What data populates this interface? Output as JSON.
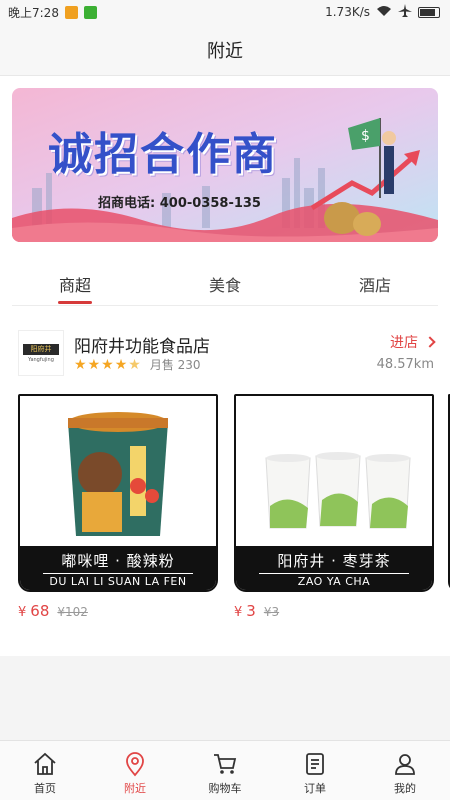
{
  "status_bar": {
    "time": "晚上7:28",
    "network_speed": "1.73K/s",
    "icons": [
      "notification-icon",
      "wechat-icon",
      "wifi-icon",
      "airplane-icon",
      "battery-icon"
    ]
  },
  "header": {
    "title": "附近"
  },
  "banner": {
    "headline": "诚招合作商",
    "hotline": "招商电话: 400-0358-135"
  },
  "tabs": [
    {
      "label": "商超",
      "active": true
    },
    {
      "label": "美食",
      "active": false
    },
    {
      "label": "酒店",
      "active": false
    }
  ],
  "store": {
    "logo_text": "阳府井",
    "logo_sub": "Yangfujing",
    "name": "阳府井功能食品店",
    "rating": 4.5,
    "monthly_sales": "月售 230",
    "enter_label": "进店",
    "distance": "48.57km"
  },
  "products": [
    {
      "name_cn": "嘟咪哩 · 酸辣粉",
      "name_en": "DU LAI LI SUAN LA FEN",
      "currency": "¥",
      "price": "68",
      "original_price": "¥102"
    },
    {
      "name_cn": "阳府井 · 枣芽茶",
      "name_en": "ZAO YA CHA",
      "currency": "¥",
      "price": "3",
      "original_price": "¥3"
    }
  ],
  "tab_bar": [
    {
      "label": "首页",
      "icon": "home-icon",
      "active": false
    },
    {
      "label": "附近",
      "icon": "location-pin-icon",
      "active": true
    },
    {
      "label": "购物车",
      "icon": "cart-icon",
      "active": false
    },
    {
      "label": "订单",
      "icon": "order-list-icon",
      "active": false
    },
    {
      "label": "我的",
      "icon": "user-icon",
      "active": false
    }
  ],
  "colors": {
    "accent": "#e14545",
    "star": "#f5a623",
    "card_border": "#111111"
  }
}
